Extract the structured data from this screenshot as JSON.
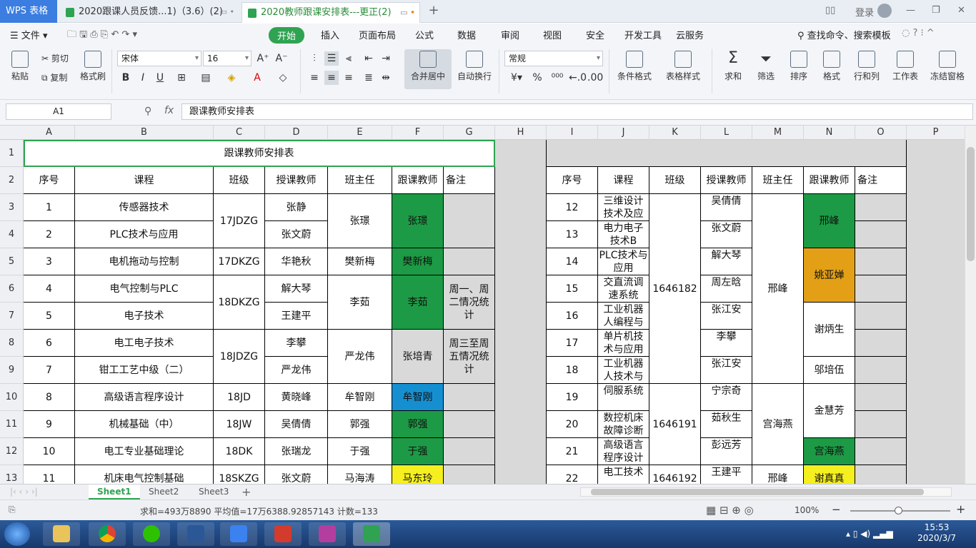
{
  "titlebar": {
    "brand": "WPS 表格",
    "tab1": "2020跟课人员反馈...1)（3.6）(2)",
    "tab2": "2020教师跟课安排表---更正(2)",
    "login": "登录"
  },
  "menu": [
    "开始",
    "插入",
    "页面布局",
    "公式",
    "数据",
    "审阅",
    "视图",
    "安全",
    "开发工具",
    "云服务"
  ],
  "menu_file": "文件",
  "search": "查找命令、搜索模板",
  "toolbar": {
    "paste": "粘贴",
    "cut": "剪切",
    "copy": "复制",
    "format_painter": "格式刷",
    "font": "宋体",
    "size": "16",
    "merge": "合并居中",
    "wrap": "自动换行",
    "numfmt": "常规",
    "cond": "条件格式",
    "tablestyle": "表格样式",
    "sum": "求和",
    "filter": "筛选",
    "sort": "排序",
    "format": "格式",
    "rowcol": "行和列",
    "sheet": "工作表",
    "freeze": "冻结窗格"
  },
  "formula_bar": {
    "cell": "A1",
    "fx": "fx",
    "content": "跟课教师安排表"
  },
  "columns": [
    "A",
    "B",
    "C",
    "D",
    "E",
    "F",
    "G",
    "H",
    "I",
    "J",
    "K",
    "L",
    "M",
    "N",
    "O",
    "P"
  ],
  "rows": [
    "1",
    "2",
    "3",
    "4",
    "5",
    "6",
    "7",
    "8",
    "9",
    "10",
    "11",
    "12",
    "13"
  ],
  "sheet": {
    "title": "跟课教师安排表",
    "headers": [
      "序号",
      "课程",
      "班级",
      "授课教师",
      "班主任",
      "跟课教师",
      "备注"
    ],
    "left": {
      "seq": [
        "1",
        "2",
        "3",
        "4",
        "5",
        "6",
        "7",
        "8",
        "9",
        "10",
        "11"
      ],
      "course": [
        "传感器技术",
        "PLC技术与应用",
        "电机拖动与控制",
        "电气控制与PLC",
        "电子技术",
        "电工电子技术",
        "钳工工艺中级（二）",
        "高级语言程序设计",
        "机械基础（中）",
        "电工专业基础理论",
        "机床电气控制基础"
      ],
      "class": [
        "17JDZG",
        "17DKZG",
        "18DKZG",
        "18JDZG",
        "18JD",
        "18JW",
        "18DK",
        "18SKZG"
      ],
      "teacher": [
        "张静",
        "张文蔚",
        "华艳秋",
        "解大琴",
        "王建平",
        "李攀",
        "严龙伟",
        "黄晓峰",
        "吴倩倩",
        "张瑞龙",
        "张文蔚"
      ],
      "head": [
        "张璟",
        "樊新梅",
        "李茹",
        "严龙伟",
        "牟智刚",
        "郭强",
        "于强",
        "马海涛"
      ],
      "follow": [
        "张璟",
        "樊新梅",
        "李茹",
        "张培青",
        "牟智刚",
        "郭强",
        "于强",
        "马东玲"
      ],
      "note": [
        "周一、周二情况统计",
        "周三至周五情况统计"
      ]
    },
    "right": {
      "seq": [
        "12",
        "13",
        "14",
        "15",
        "16",
        "17",
        "18",
        "19",
        "20",
        "21",
        "22"
      ],
      "course": [
        "三维设计技术及应",
        "电力电子技术B",
        "PLC技术与应用",
        "交直流调速系统",
        "工业机器人编程与",
        "单片机技术与应用",
        "工业机器人技术与",
        "伺服系统",
        "数控机床故障诊断",
        "高级语言程序设计",
        "电工技术"
      ],
      "class": [
        "1646182",
        "1646191",
        "1646192"
      ],
      "teacher": [
        "吴倩倩",
        "张文蔚",
        "解大琴",
        "周左晗",
        "张江安",
        "李攀",
        "张江安",
        "宁宗奇",
        "茹秋生",
        "彭远芳",
        "王建平"
      ],
      "head": [
        "邢峰",
        "宫海燕",
        "邢峰"
      ],
      "follow": [
        "邢峰",
        "姚亚婵",
        "谢炳生",
        "邬培伍",
        "金慧芳",
        "宫海燕",
        "谢真真"
      ]
    }
  },
  "sheet_tabs": [
    "Sheet1",
    "Sheet2",
    "Sheet3"
  ],
  "status": {
    "text": "求和=493万8890  平均值=17万6388.92857143  计数=133",
    "zoom": "100%"
  },
  "clock": {
    "time": "15:53",
    "date": "2020/3/7"
  },
  "colors": {
    "accent": "#2fa351",
    "green": "#1d9a45",
    "orange": "#e3a016",
    "blue": "#168fd1",
    "yellow": "#f5ef1f"
  }
}
